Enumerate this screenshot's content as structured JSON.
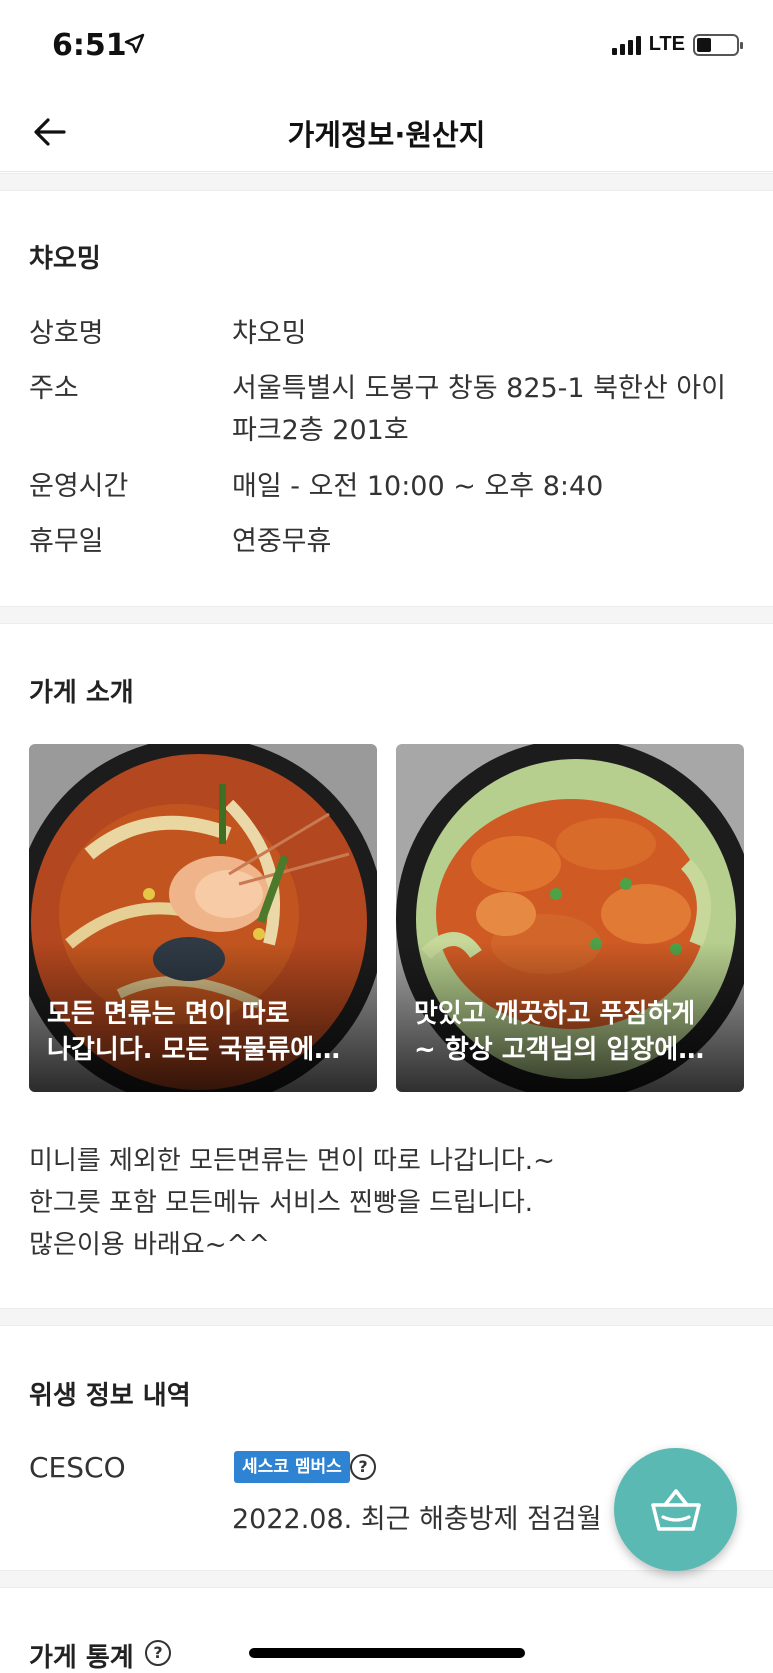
{
  "status_bar": {
    "time": "6:51",
    "network": "LTE"
  },
  "header": {
    "title": "가게정보·원산지"
  },
  "store_info": {
    "name": "챠오밍",
    "rows": [
      {
        "label": "상호명",
        "value_lines": [
          "챠오밍"
        ]
      },
      {
        "label": "주소",
        "value_lines": [
          "서울특별시 도봉구 창동 825-1 북한산 아이",
          "파크2층 201호"
        ]
      },
      {
        "label": "운영시간",
        "value_lines": [
          "매일 - 오전 10:00 ~ 오후 8:40"
        ]
      },
      {
        "label": "휴무일",
        "value_lines": [
          "연중무휴"
        ]
      }
    ]
  },
  "intro": {
    "title": "가게 소개",
    "photos": [
      {
        "caption_lines": [
          "모든 면류는 면이 따로",
          "나갑니다. 모든 국물류에…"
        ]
      },
      {
        "caption_lines": [
          "맛있고 깨끗하고 푸짐하게",
          "~ 항상 고객님의 입장에…"
        ]
      }
    ],
    "text_lines": [
      "미니를 제외한 모든면류는 면이 따로 나갑니다.~",
      "한그릇 포함 모든메뉴 서비스 찐빵을 드립니다.",
      "많은이용 바래요~^^"
    ]
  },
  "hygiene": {
    "title": "위생 정보 내역",
    "provider": "CESCO",
    "badge": "세스코 멤버스",
    "help": "?",
    "date_text": "2022.08. 최근 해충방제 점검월"
  },
  "stats": {
    "title": "가게 통계",
    "help": "?"
  },
  "colors": {
    "accent": "#5ab9b3",
    "badge": "#2f83d3",
    "divider": "#f5f5f5"
  }
}
